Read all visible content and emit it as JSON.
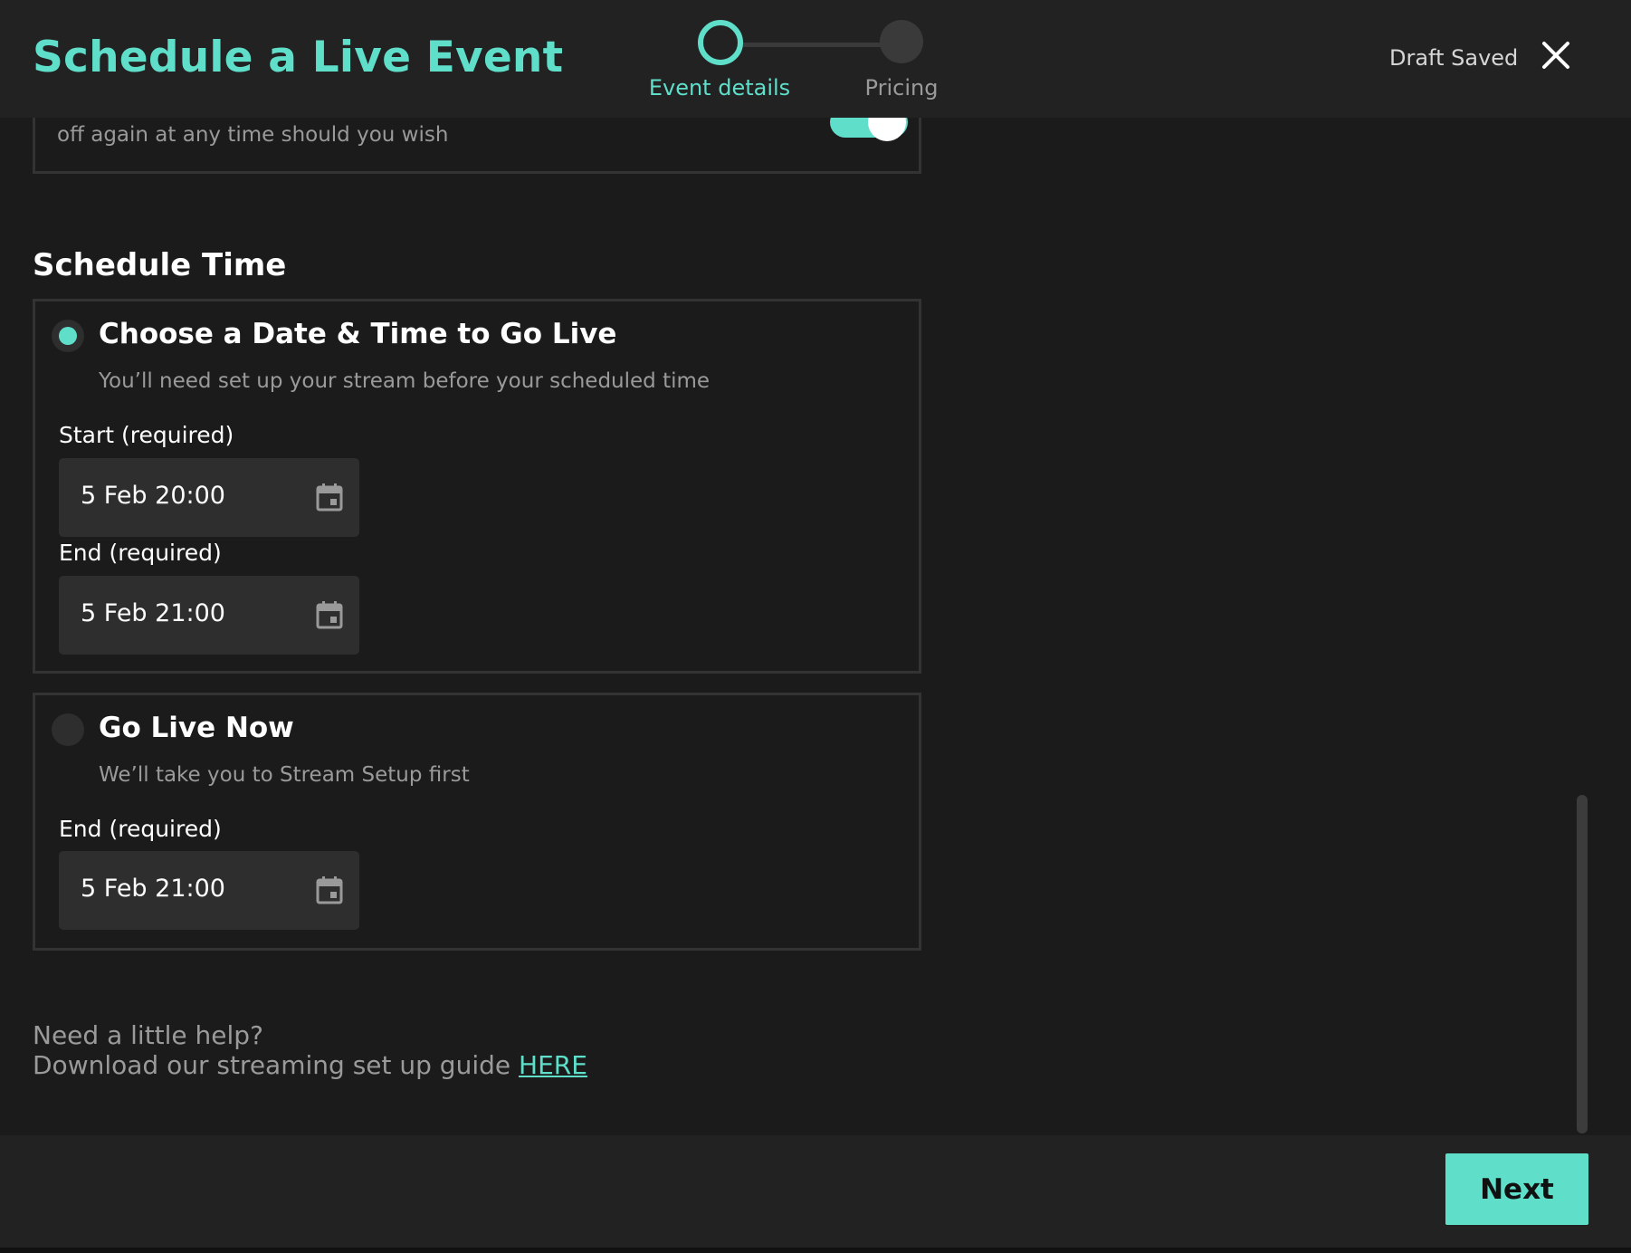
{
  "header": {
    "title": "Schedule a Live Event",
    "draft_status": "Draft Saved",
    "close_icon": "close-icon",
    "steps": [
      {
        "label": "Event details",
        "active": true
      },
      {
        "label": "Pricing",
        "active": false
      }
    ]
  },
  "visibility_card": {
    "text": "off again at any time should you wish",
    "toggle_on": true
  },
  "schedule": {
    "heading": "Schedule Time",
    "options": [
      {
        "title": "Choose a Date & Time to Go Live",
        "description": "You’ll need set up your stream before your scheduled time",
        "selected": true,
        "fields": [
          {
            "label": "Start (required)",
            "value": "5 Feb 20:00",
            "icon": "calendar-icon"
          },
          {
            "label": "End (required)",
            "value": "5 Feb 21:00",
            "icon": "calendar-icon"
          }
        ]
      },
      {
        "title": "Go Live Now",
        "description": "We’ll take you to Stream Setup first",
        "selected": false,
        "fields": [
          {
            "label": "End (required)",
            "value": "5 Feb 21:00",
            "icon": "calendar-icon"
          }
        ]
      }
    ]
  },
  "help": {
    "line1": "Need a little help?",
    "line2": "Download our streaming set up guide ",
    "link_text": "HERE"
  },
  "footer": {
    "next_label": "Next"
  },
  "colors": {
    "accent": "#5fdfca",
    "background": "#1b1b1b",
    "panel": "#222222",
    "field": "#2e2e2e",
    "muted_text": "#9a9a9a"
  }
}
